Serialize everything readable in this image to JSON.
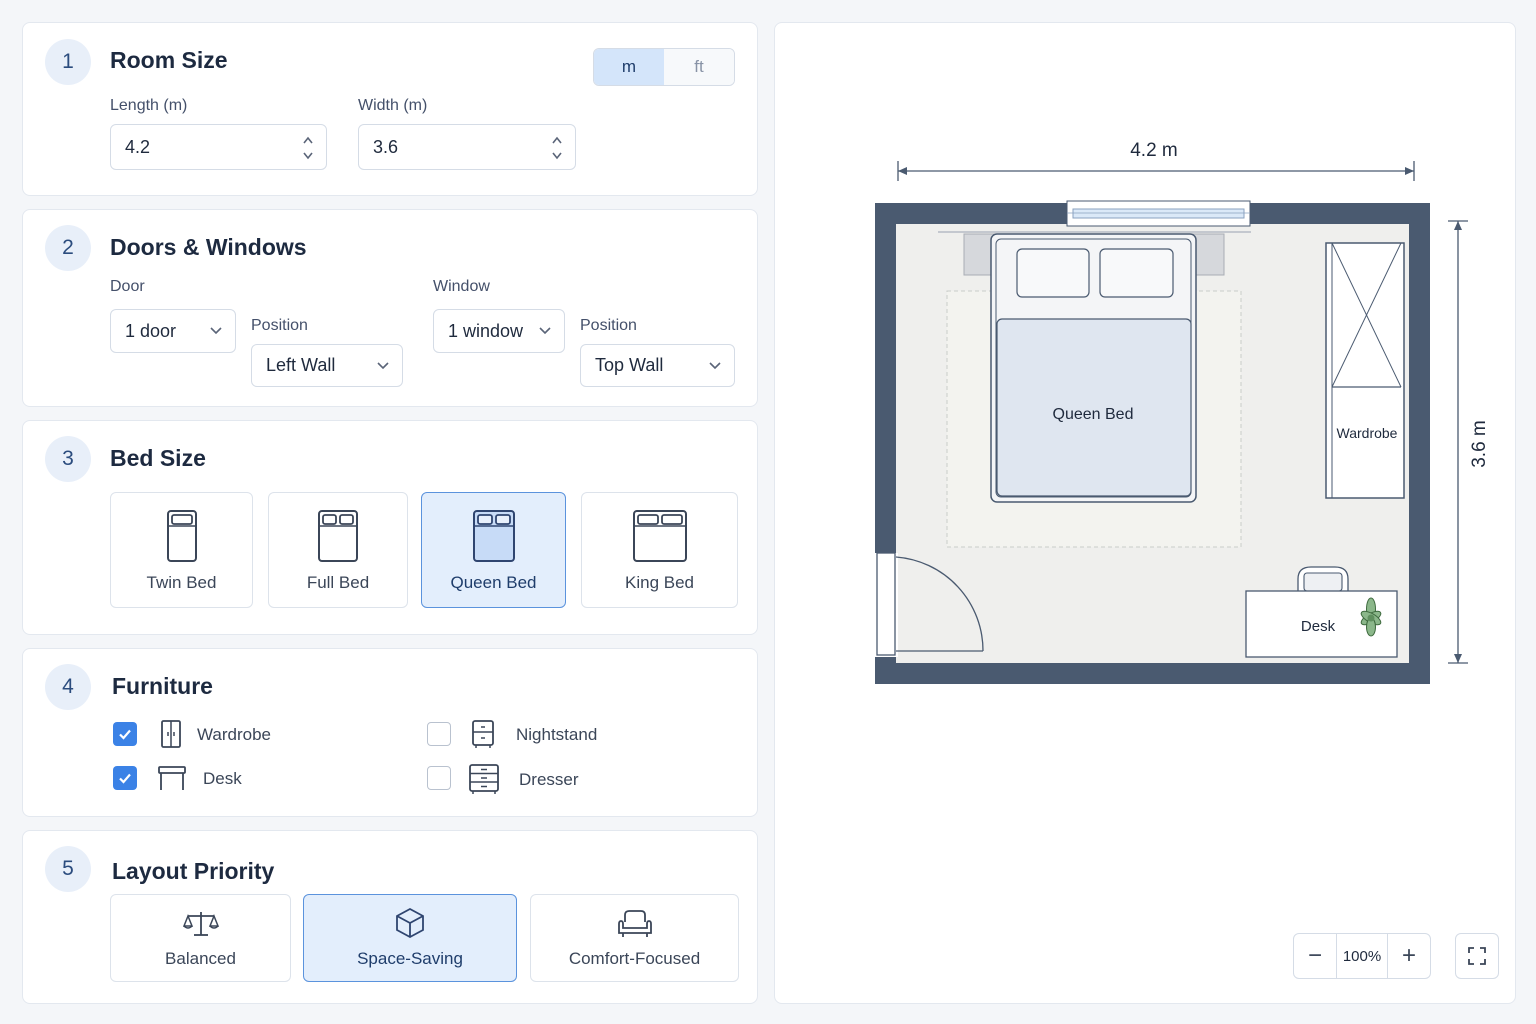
{
  "room_size": {
    "step": "1",
    "title": "Room Size",
    "unit_options": [
      "m",
      "ft"
    ],
    "selected_unit": "m",
    "length_label": "Length (m)",
    "length_value": "4.2",
    "width_label": "Width (m)",
    "width_value": "3.6"
  },
  "doors_windows": {
    "step": "2",
    "title": "Doors & Windows",
    "door_label": "Door",
    "door_value": "1 door",
    "door_position_label": "Position",
    "door_position_value": "Left Wall",
    "window_label": "Window",
    "window_value": "1 window",
    "window_position_label": "Position",
    "window_position_value": "Top Wall"
  },
  "bed_size": {
    "step": "3",
    "title": "Bed Size",
    "options": [
      {
        "label": "Twin Bed",
        "selected": false,
        "icon": "twin-bed-icon"
      },
      {
        "label": "Full Bed",
        "selected": false,
        "icon": "full-bed-icon"
      },
      {
        "label": "Queen Bed",
        "selected": true,
        "icon": "queen-bed-icon"
      },
      {
        "label": "King Bed",
        "selected": false,
        "icon": "king-bed-icon"
      }
    ]
  },
  "furniture": {
    "step": "4",
    "title": "Furniture",
    "items": [
      {
        "label": "Wardrobe",
        "checked": true,
        "icon": "wardrobe-icon"
      },
      {
        "label": "Nightstand",
        "checked": false,
        "icon": "nightstand-icon"
      },
      {
        "label": "Desk",
        "checked": true,
        "icon": "desk-icon"
      },
      {
        "label": "Dresser",
        "checked": false,
        "icon": "dresser-icon"
      }
    ]
  },
  "layout_priority": {
    "step": "5",
    "title": "Layout Priority",
    "options": [
      {
        "label": "Balanced",
        "selected": false,
        "icon": "scale-icon"
      },
      {
        "label": "Space-Saving",
        "selected": true,
        "icon": "cube-icon"
      },
      {
        "label": "Comfort-Focused",
        "selected": false,
        "icon": "armchair-icon"
      }
    ]
  },
  "preview": {
    "width_dimension": "4.2 m",
    "height_dimension": "3.6 m",
    "bed_label": "Queen Bed",
    "wardrobe_label": "Wardrobe",
    "desk_label": "Desk",
    "zoom_level": "100%",
    "zoom_out": "−",
    "zoom_in": "+"
  },
  "colors": {
    "accent": "#3b82e6",
    "selected_fill": "#e3eefc",
    "wall": "#4a5a70",
    "floor": "#efefed"
  }
}
